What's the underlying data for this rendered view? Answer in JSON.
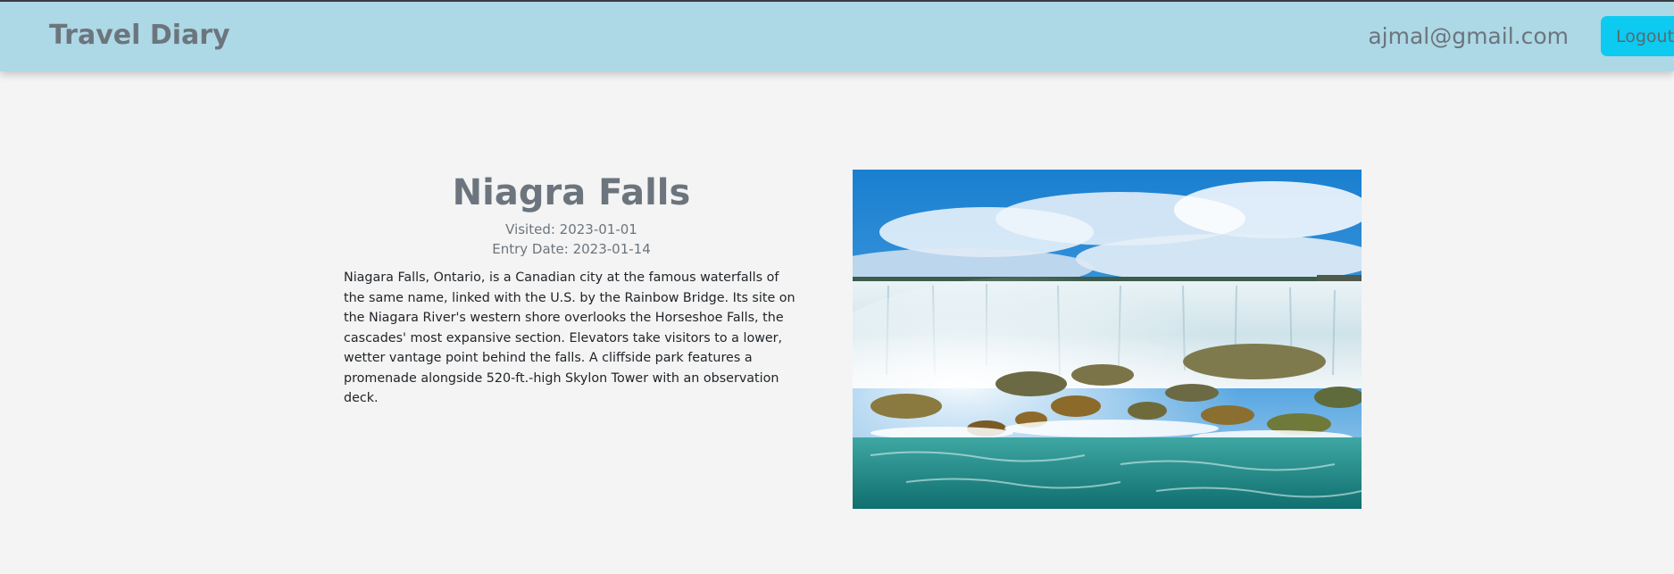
{
  "navbar": {
    "brand": "Travel Diary",
    "user_email": "ajmal@gmail.com",
    "logout_label": "Logout"
  },
  "entry": {
    "title": "Niagra Falls",
    "visited": "Visited: 2023-01-01",
    "entry_date": "Entry Date: 2023-01-14",
    "description": "Niagara Falls, Ontario, is a Canadian city at the famous waterfalls of the same name, linked with the U.S. by the Rainbow Bridge. Its site on the Niagara River's western shore overlooks the Horseshoe Falls, the cascades' most expansive section. Elevators take visitors to a lower, wetter vantage point behind the falls. A cliffside park features a promenade alongside 520-ft.-high Skylon Tower with an observation deck."
  },
  "colors": {
    "navbar_bg": "#add8e6",
    "logout_bg": "#0dcaf0",
    "page_bg": "#f4f4f4"
  }
}
